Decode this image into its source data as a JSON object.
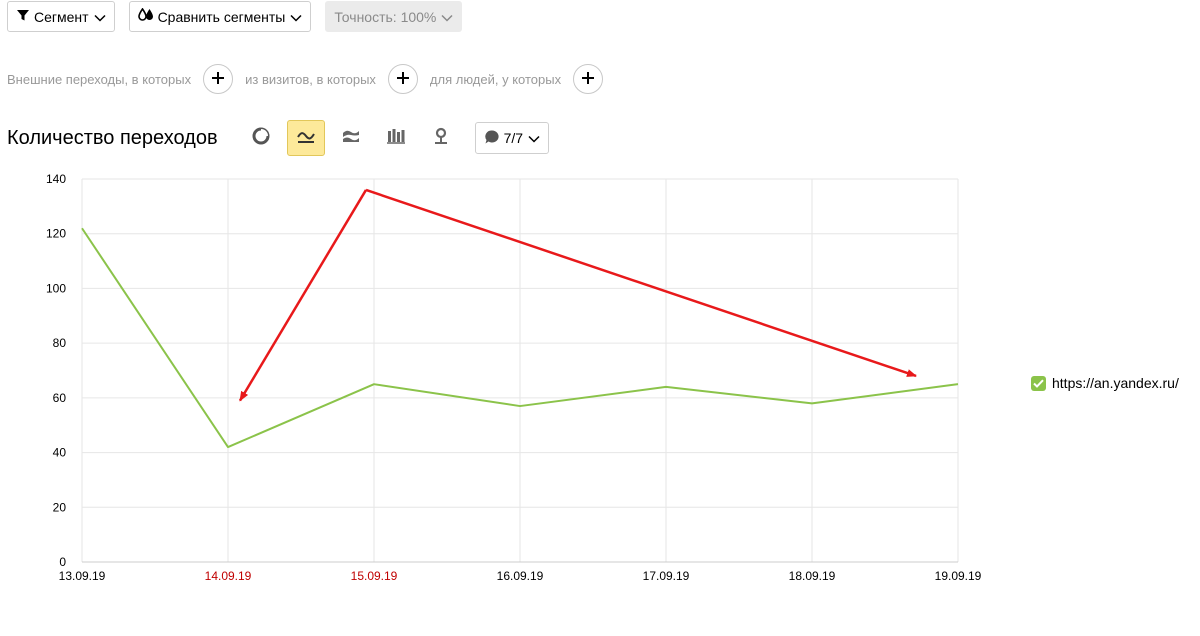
{
  "toolbar": {
    "segment_label": "Сегмент",
    "compare_label": "Сравнить сегменты",
    "accuracy_label": "Точность: 100%"
  },
  "filters": {
    "first": "Внешние переходы, в которых",
    "second": "из визитов, в которых",
    "third": "для людей, у которых"
  },
  "chart_header": {
    "title": "Количество переходов",
    "annotations_count": "7/7",
    "active_type": "line"
  },
  "colors": {
    "series": "#8bc34a",
    "arrow": "#e8191b",
    "highlight_tick": "#c00000",
    "grid": "#e6e6e6"
  },
  "chart_data": {
    "type": "line",
    "categories": [
      "13.09.19",
      "14.09.19",
      "15.09.19",
      "16.09.19",
      "17.09.19",
      "18.09.19",
      "19.09.19"
    ],
    "highlighted_categories": [
      "14.09.19",
      "15.09.19"
    ],
    "series": [
      {
        "name": "https://an.yandex.ru/",
        "values": [
          122,
          42,
          65,
          57,
          64,
          58,
          65
        ]
      }
    ],
    "ylim": [
      0,
      140
    ],
    "yticks": [
      0,
      20,
      40,
      60,
      80,
      100,
      120,
      140
    ],
    "grid": true,
    "legend_position": "right",
    "annotations": [
      {
        "type": "arrow",
        "from": [
          "15.09.19",
          136
        ],
        "to": [
          "14.09.19",
          59
        ]
      },
      {
        "type": "arrow",
        "from": [
          "15.09.19",
          136
        ],
        "to": [
          "19.09.19",
          68
        ]
      }
    ]
  }
}
